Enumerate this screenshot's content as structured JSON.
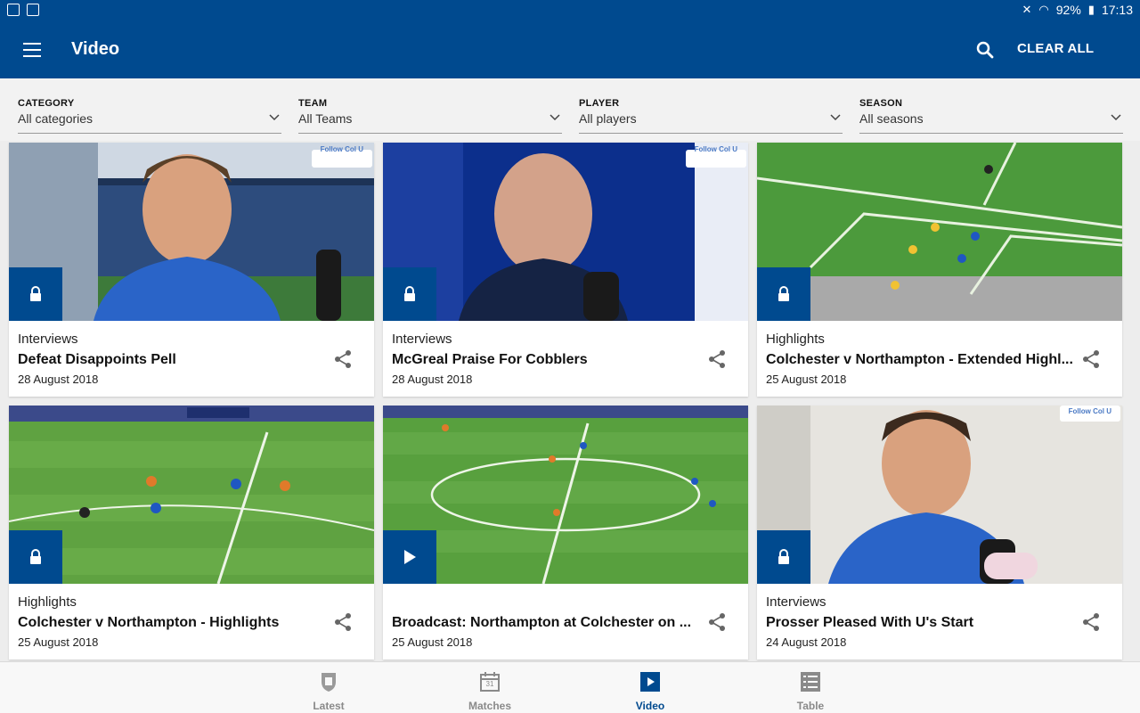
{
  "status_bar": {
    "battery": "92%",
    "time": "17:13"
  },
  "app_bar": {
    "title": "Video",
    "clear_all": "CLEAR ALL"
  },
  "filters": [
    {
      "label": "CATEGORY",
      "value": "All categories"
    },
    {
      "label": "TEAM",
      "value": "All Teams"
    },
    {
      "label": "PLAYER",
      "value": "All players"
    },
    {
      "label": "SEASON",
      "value": "All seasons"
    }
  ],
  "videos": [
    {
      "category": "Interviews",
      "title": "Defeat Disappoints Pell",
      "date": "28 August 2018",
      "access": "locked",
      "thumb_logo": "Follow Col U"
    },
    {
      "category": "Interviews",
      "title": "McGreal Praise For Cobblers",
      "date": "28 August 2018",
      "access": "locked",
      "thumb_logo": "Follow Col U"
    },
    {
      "category": "Highlights",
      "title": "Colchester v Northampton - Extended Highl...",
      "date": "25 August 2018",
      "access": "locked"
    },
    {
      "category": "Highlights",
      "title": "Colchester v Northampton - Highlights",
      "date": "25 August 2018",
      "access": "locked"
    },
    {
      "category": "",
      "title": "Broadcast: Northampton at Colchester on ...",
      "date": "25 August 2018",
      "access": "play"
    },
    {
      "category": "Interviews",
      "title": "Prosser Pleased With U's Start",
      "date": "24 August 2018",
      "access": "locked",
      "thumb_logo": "Follow Col U"
    }
  ],
  "bottom_nav": [
    {
      "label": "Latest",
      "icon": "crest-icon",
      "active": false
    },
    {
      "label": "Matches",
      "icon": "calendar-icon",
      "calendar_day": "31",
      "active": false
    },
    {
      "label": "Video",
      "icon": "video-play-icon",
      "active": true
    },
    {
      "label": "Table",
      "icon": "table-list-icon",
      "active": false
    }
  ],
  "colors": {
    "brand": "#004a8f",
    "background": "#ededed",
    "card": "#ffffff",
    "inactive_nav": "#8a8a8a"
  }
}
